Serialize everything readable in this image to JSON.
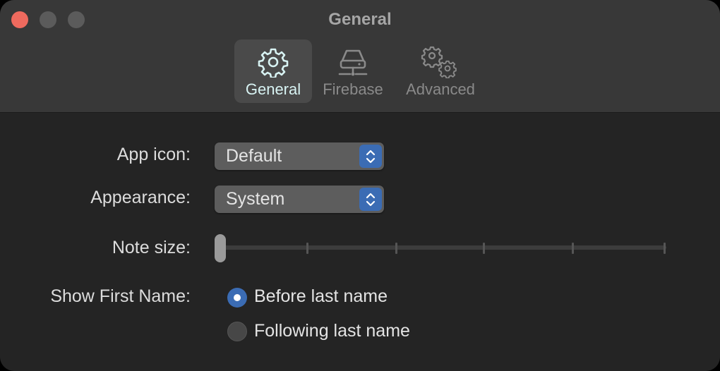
{
  "window": {
    "title": "General",
    "traffic_lights": {
      "close_color": "#ee6a5e",
      "inactive_color": "#5b5b5b"
    }
  },
  "toolbar": {
    "tabs": [
      {
        "label": "General",
        "icon": "gear-icon",
        "selected": true
      },
      {
        "label": "Firebase",
        "icon": "server-icon",
        "selected": false
      },
      {
        "label": "Advanced",
        "icon": "gears-icon",
        "selected": false
      }
    ]
  },
  "settings": {
    "app_icon": {
      "label": "App icon:",
      "value": "Default"
    },
    "appearance": {
      "label": "Appearance:",
      "value": "System"
    },
    "note_size": {
      "label": "Note size:",
      "level": 0,
      "steps": 6
    },
    "show_first_name": {
      "label": "Show First Name:",
      "options": [
        {
          "label": "Before last name",
          "selected": true
        },
        {
          "label": "Following last name",
          "selected": false
        }
      ]
    }
  },
  "colors": {
    "accent": "#3b6cb4",
    "selected_tab_label": "#d8f3f3"
  }
}
